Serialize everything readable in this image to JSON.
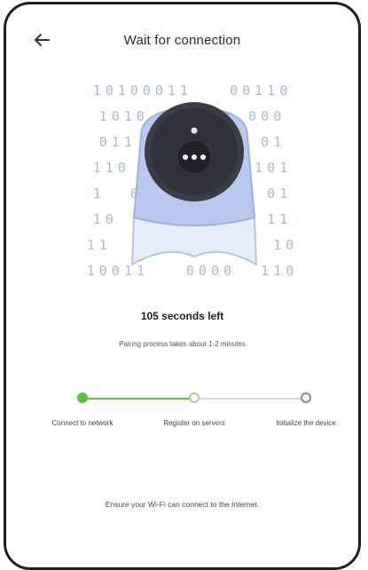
{
  "header": {
    "title": "Wait for connection",
    "back_icon": "arrow-left-icon"
  },
  "hero": {
    "binary_rows": [
      "10100011   00110",
      "1010        000",
      "011          01",
      "110          101",
      "1  0          01",
      "10  1         11",
      "11             10",
      "10011   0000  110"
    ],
    "device_icon": "camera-icon"
  },
  "status": {
    "countdown": "105 seconds left",
    "subtitle": "Pairing process takes about 1-2 minutes"
  },
  "steps": [
    {
      "label": "Connect to network",
      "state": "done"
    },
    {
      "label": "Register on servers",
      "state": "active"
    },
    {
      "label": "Initialize the device",
      "state": "pending"
    }
  ],
  "footer": {
    "note": "Ensure your Wi-Fi can connect to the Internet."
  },
  "colors": {
    "progress_done": "#5fbf47",
    "binary": "#a6b8df",
    "camera_body": "#b8c8ee"
  }
}
